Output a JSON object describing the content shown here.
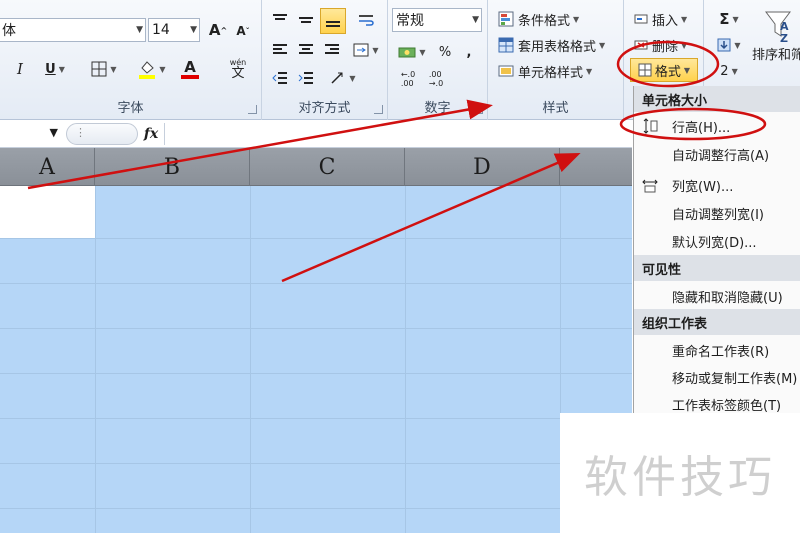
{
  "ribbon": {
    "font": {
      "name_value": "体",
      "size_value": "14",
      "grow_font": "A",
      "shrink_font": "A",
      "underline": "U",
      "font_color_letter": "A",
      "phonetic": "wén",
      "label": "字体"
    },
    "alignment": {
      "label": "对齐方式"
    },
    "number": {
      "format_value": "常规",
      "percent": "%",
      "comma": ",",
      "label": "数字"
    },
    "styles": {
      "conditional": "条件格式",
      "table": "套用表格格式",
      "cell": "单元格样式",
      "label": "样式"
    },
    "cells": {
      "insert": "插入",
      "delete": "删除",
      "format": "格式"
    },
    "editing": {
      "sum": "Σ",
      "sort": "排序和筛"
    }
  },
  "formula_bar": {
    "fx": "fx"
  },
  "columns": [
    "A",
    "B",
    "C",
    "D"
  ],
  "menu": {
    "sections": [
      {
        "title": "单元格大小",
        "items": [
          "行高(H)...",
          "自动调整行高(A)",
          "列宽(W)...",
          "自动调整列宽(I)",
          "默认列宽(D)..."
        ]
      },
      {
        "title": "可见性",
        "items": [
          "隐藏和取消隐藏(U)"
        ]
      },
      {
        "title": "组织工作表",
        "items": [
          "重命名工作表(R)",
          "移动或复制工作表(M)",
          "工作表标签颜色(T)"
        ]
      }
    ]
  },
  "watermark": "软件技巧",
  "colors": {
    "selection": "#b5d6f7",
    "annotation": "#d01010",
    "menu_highlight": "#ffd24d"
  }
}
